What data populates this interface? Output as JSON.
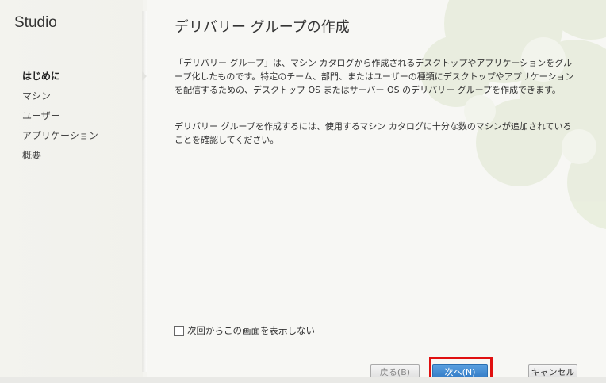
{
  "app": {
    "title": "Studio"
  },
  "sidebar": {
    "steps": [
      {
        "label": "はじめに",
        "active": true
      },
      {
        "label": "マシン",
        "active": false
      },
      {
        "label": "ユーザー",
        "active": false
      },
      {
        "label": "アプリケーション",
        "active": false
      },
      {
        "label": "概要",
        "active": false
      }
    ]
  },
  "main": {
    "title": "デリバリー グループの作成",
    "paragraph1": "「デリバリー グループ」は、マシン カタログから作成されるデスクトップやアプリケーションをグループ化したものです。特定のチーム、部門、またはユーザーの種類にデスクトップやアプリケーションを配信するための、デスクトップ OS またはサーバー OS のデリバリー グループを作成できます。",
    "paragraph2": "デリバリー グループを作成するには、使用するマシン カタログに十分な数のマシンが追加されていることを確認してください。",
    "skip_checkbox": {
      "label": "次回からこの画面を表示しない",
      "checked": false
    }
  },
  "footer": {
    "back_label": "戻る(B)",
    "next_label": "次へ(N)",
    "cancel_label": "キャンセル"
  },
  "colors": {
    "accent": "#2f78c4",
    "highlight": "#e01010",
    "art_green": "#e7eddc"
  }
}
